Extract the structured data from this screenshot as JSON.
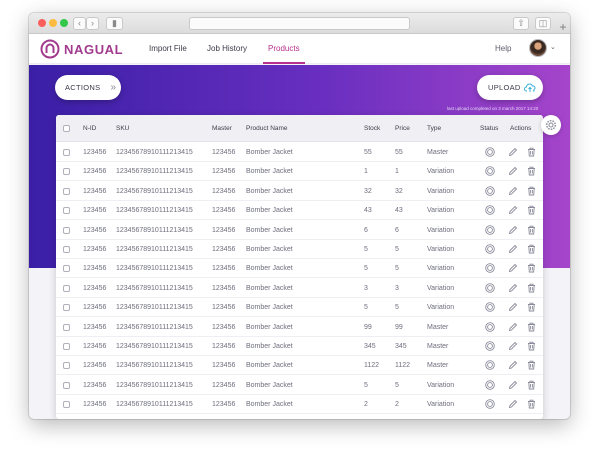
{
  "app": {
    "logo_text": "NAGUAL",
    "nav": [
      {
        "label": "Import File"
      },
      {
        "label": "Job History"
      },
      {
        "label": "Products"
      }
    ],
    "help_label": "Help"
  },
  "toolbar": {
    "actions_label": "ACTIONS",
    "upload_label": "UPLOAD",
    "last_upload": "last upload completed on 3 march 2017 14:20"
  },
  "colors": {
    "accent": "#b8308e",
    "hero_start": "#3a1fa6",
    "hero_end": "#a545cb"
  },
  "table": {
    "headers": {
      "nid": "N-ID",
      "sku": "SKU",
      "master": "Master",
      "pname": "Product Name",
      "stock": "Stock",
      "price": "Price",
      "type": "Type",
      "status": "Status",
      "actions": "Actions"
    },
    "rows": [
      {
        "nid": "123456",
        "sku": "12345678910111213415",
        "master": "123456",
        "pname": "Bomber Jacket",
        "stock": "55",
        "price": "55",
        "type": "Master"
      },
      {
        "nid": "123456",
        "sku": "12345678910111213415",
        "master": "123456",
        "pname": "Bomber Jacket",
        "stock": "1",
        "price": "1",
        "type": "Variation"
      },
      {
        "nid": "123456",
        "sku": "12345678910111213415",
        "master": "123456",
        "pname": "Bomber Jacket",
        "stock": "32",
        "price": "32",
        "type": "Variation"
      },
      {
        "nid": "123456",
        "sku": "12345678910111213415",
        "master": "123456",
        "pname": "Bomber Jacket",
        "stock": "43",
        "price": "43",
        "type": "Variation"
      },
      {
        "nid": "123456",
        "sku": "12345678910111213415",
        "master": "123456",
        "pname": "Bomber Jacket",
        "stock": "6",
        "price": "6",
        "type": "Variation"
      },
      {
        "nid": "123456",
        "sku": "12345678910111213415",
        "master": "123456",
        "pname": "Bomber Jacket",
        "stock": "5",
        "price": "5",
        "type": "Variation"
      },
      {
        "nid": "123456",
        "sku": "12345678910111213415",
        "master": "123456",
        "pname": "Bomber Jacket",
        "stock": "5",
        "price": "5",
        "type": "Variation"
      },
      {
        "nid": "123456",
        "sku": "12345678910111213415",
        "master": "123456",
        "pname": "Bomber Jacket",
        "stock": "3",
        "price": "3",
        "type": "Variation"
      },
      {
        "nid": "123456",
        "sku": "12345678910111213415",
        "master": "123456",
        "pname": "Bomber Jacket",
        "stock": "5",
        "price": "5",
        "type": "Variation"
      },
      {
        "nid": "123456",
        "sku": "12345678910111213415",
        "master": "123456",
        "pname": "Bomber Jacket",
        "stock": "99",
        "price": "99",
        "type": "Master"
      },
      {
        "nid": "123456",
        "sku": "12345678910111213415",
        "master": "123456",
        "pname": "Bomber Jacket",
        "stock": "345",
        "price": "345",
        "type": "Master"
      },
      {
        "nid": "123456",
        "sku": "12345678910111213415",
        "master": "123456",
        "pname": "Bomber Jacket",
        "stock": "1122",
        "price": "1122",
        "type": "Master"
      },
      {
        "nid": "123456",
        "sku": "12345678910111213415",
        "master": "123456",
        "pname": "Bomber Jacket",
        "stock": "5",
        "price": "5",
        "type": "Variation"
      },
      {
        "nid": "123456",
        "sku": "12345678910111213415",
        "master": "123456",
        "pname": "Bomber Jacket",
        "stock": "2",
        "price": "2",
        "type": "Variation"
      }
    ]
  }
}
